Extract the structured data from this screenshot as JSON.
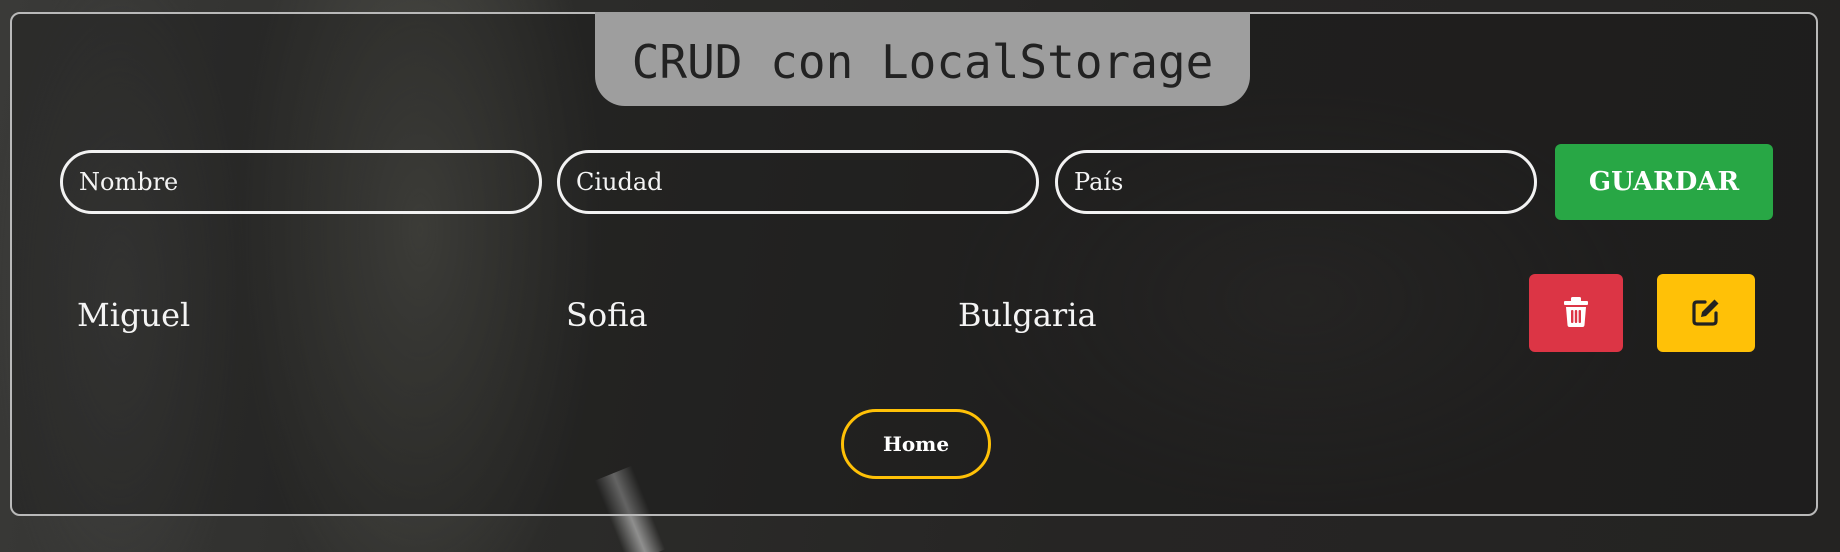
{
  "header": {
    "title": "CRUD con LocalStorage"
  },
  "form": {
    "nombre": {
      "placeholder": "Nombre",
      "value": ""
    },
    "ciudad": {
      "placeholder": "Ciudad",
      "value": ""
    },
    "pais": {
      "placeholder": "País",
      "value": ""
    },
    "save_label": "GUARDAR"
  },
  "records": [
    {
      "nombre": "Miguel",
      "ciudad": "Sofia",
      "pais": "Bulgaria"
    }
  ],
  "actions": {
    "delete_icon": "trash-icon",
    "edit_icon": "edit-icon"
  },
  "nav": {
    "home_label": "Home"
  },
  "colors": {
    "save": "#28a745",
    "delete": "#dc3545",
    "edit": "#ffc107",
    "title_tab": "#9e9e9e"
  }
}
